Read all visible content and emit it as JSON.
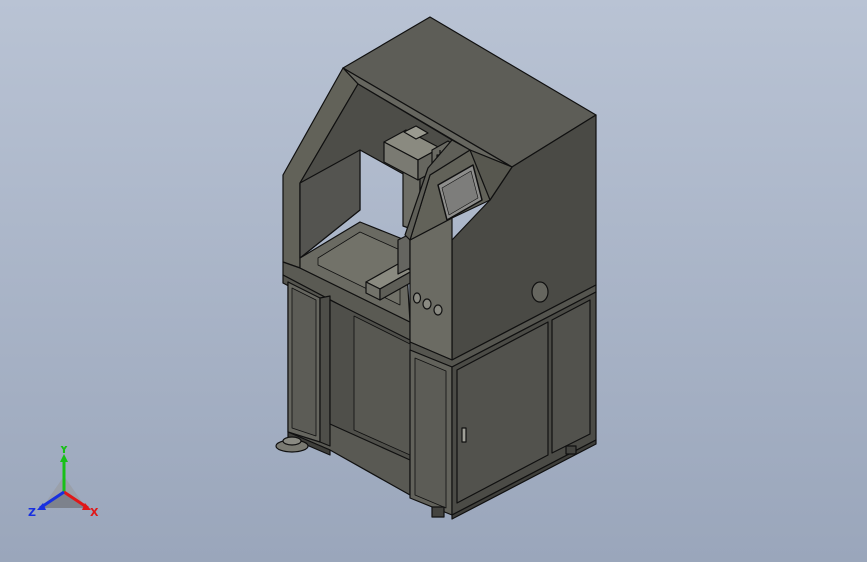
{
  "viewport": {
    "background_top": "#b9c3d4",
    "background_bottom": "#9aa6bb"
  },
  "model": {
    "body_color": "#5b5b55",
    "edge_color": "#101010"
  },
  "triad": {
    "x_label": "X",
    "y_label": "Y",
    "z_label": "Z",
    "x_color": "#e01818",
    "y_color": "#18c018",
    "z_color": "#1830e0"
  }
}
